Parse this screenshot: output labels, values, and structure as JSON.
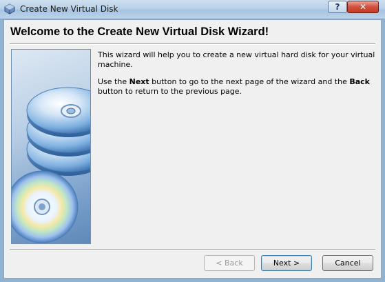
{
  "window": {
    "title": "Create New Virtual Disk",
    "help_label": "?",
    "close_label": "✕"
  },
  "header": {
    "title": "Welcome to the Create New Virtual Disk Wizard!"
  },
  "content": {
    "para1": "This wizard will help you to create a new virtual hard disk for your virtual machine.",
    "para2_prefix": "Use the ",
    "para2_next": "Next",
    "para2_middle": " button to go to the next page of the wizard and the ",
    "para2_back": "Back",
    "para2_suffix": " button to return to the previous page."
  },
  "buttons": {
    "back": "< Back",
    "next": "Next >",
    "cancel": "Cancel"
  },
  "colors": {
    "accent": "#3c7fb1",
    "sidebar": "#7ea3cc",
    "close": "#c23b27"
  }
}
